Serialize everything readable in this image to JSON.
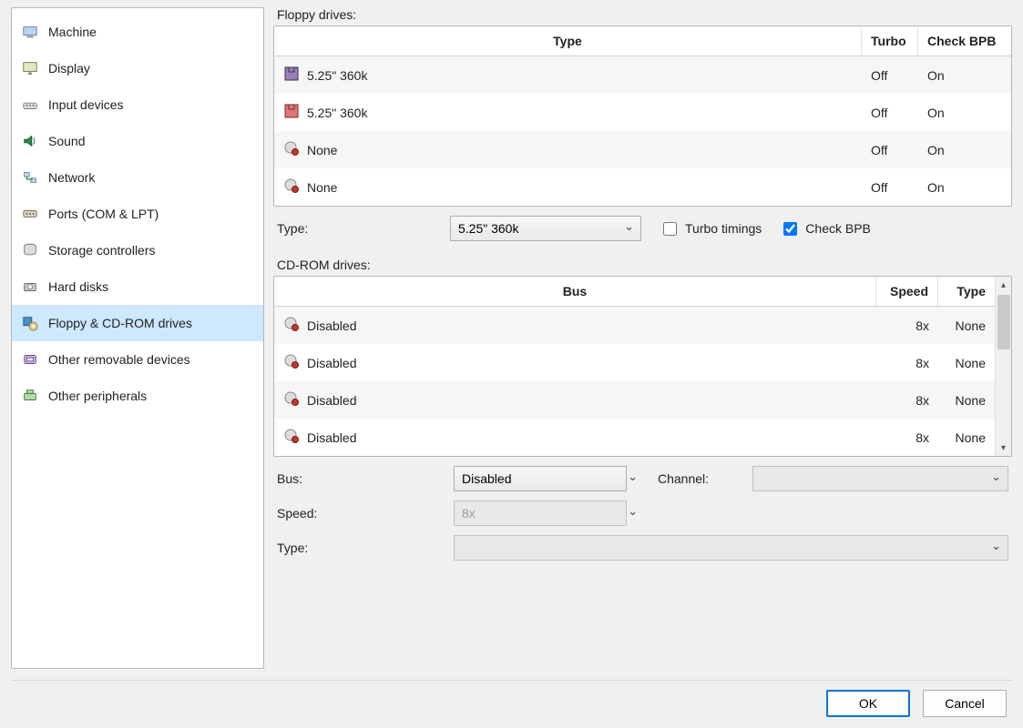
{
  "sidebar": {
    "items": [
      {
        "label": "Machine",
        "icon": "machine-icon",
        "selected": false
      },
      {
        "label": "Display",
        "icon": "display-icon",
        "selected": false
      },
      {
        "label": "Input devices",
        "icon": "input-icon",
        "selected": false
      },
      {
        "label": "Sound",
        "icon": "sound-icon",
        "selected": false
      },
      {
        "label": "Network",
        "icon": "network-icon",
        "selected": false
      },
      {
        "label": "Ports (COM & LPT)",
        "icon": "ports-icon",
        "selected": false
      },
      {
        "label": "Storage controllers",
        "icon": "storage-icon",
        "selected": false
      },
      {
        "label": "Hard disks",
        "icon": "hdd-icon",
        "selected": false
      },
      {
        "label": "Floppy & CD-ROM drives",
        "icon": "floppy-cd-icon",
        "selected": true
      },
      {
        "label": "Other removable devices",
        "icon": "removable-icon",
        "selected": false
      },
      {
        "label": "Other peripherals",
        "icon": "periph-icon",
        "selected": false
      }
    ]
  },
  "floppy": {
    "section_label": "Floppy drives:",
    "columns": {
      "type": "Type",
      "turbo": "Turbo",
      "check_bpb": "Check BPB"
    },
    "rows": [
      {
        "icon": "floppy-a-icon",
        "type": "5.25\" 360k",
        "turbo": "Off",
        "check_bpb": "On"
      },
      {
        "icon": "floppy-b-icon",
        "type": "5.25\" 360k",
        "turbo": "Off",
        "check_bpb": "On"
      },
      {
        "icon": "none-icon",
        "type": "None",
        "turbo": "Off",
        "check_bpb": "On"
      },
      {
        "icon": "none-icon",
        "type": "None",
        "turbo": "Off",
        "check_bpb": "On"
      }
    ],
    "detail": {
      "type_label": "Type:",
      "type_value": "5.25\" 360k",
      "turbo_label": "Turbo timings",
      "turbo_checked": false,
      "check_bpb_label": "Check BPB",
      "check_bpb_checked": true
    }
  },
  "cdrom": {
    "section_label": "CD-ROM drives:",
    "columns": {
      "bus": "Bus",
      "speed": "Speed",
      "type": "Type"
    },
    "rows": [
      {
        "icon": "none-icon",
        "bus": "Disabled",
        "speed": "8x",
        "type": "None"
      },
      {
        "icon": "none-icon",
        "bus": "Disabled",
        "speed": "8x",
        "type": "None"
      },
      {
        "icon": "none-icon",
        "bus": "Disabled",
        "speed": "8x",
        "type": "None"
      },
      {
        "icon": "none-icon",
        "bus": "Disabled",
        "speed": "8x",
        "type": "None"
      }
    ],
    "detail": {
      "bus_label": "Bus:",
      "bus_value": "Disabled",
      "channel_label": "Channel:",
      "channel_value": "",
      "speed_label": "Speed:",
      "speed_value": "8x",
      "type_label": "Type:",
      "type_value": ""
    }
  },
  "buttons": {
    "ok": "OK",
    "cancel": "Cancel"
  }
}
